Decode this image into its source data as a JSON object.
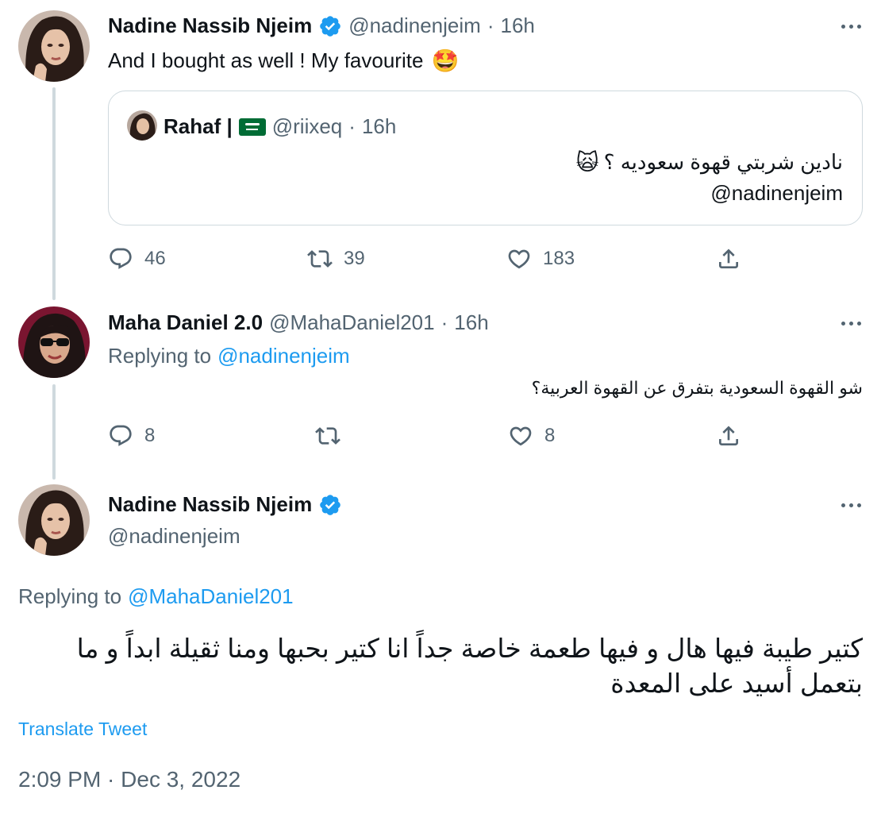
{
  "tweet1": {
    "name": "Nadine Nassib Njeim",
    "handle": "@nadinenjeim",
    "sep": "·",
    "time": "16h",
    "text": "And I bought as well ! My favourite",
    "emoji": "🤩",
    "quote": {
      "name": "Rahaf |",
      "handle": "@riixeq",
      "sep": "·",
      "time": "16h",
      "line1": "نادين شربتي قهوة سعوديه ؟",
      "line1_emoji": "🙀",
      "line2": "@nadinenjeim"
    },
    "counts": {
      "replies": "46",
      "retweets": "39",
      "likes": "183"
    }
  },
  "tweet2": {
    "name": "Maha Daniel 2.0",
    "handle": "@MahaDaniel201",
    "sep": "·",
    "time": "16h",
    "replying_prefix": "Replying to",
    "replying_handle": "@nadinenjeim",
    "text": "شو القهوة السعودية بتفرق عن القهوة العربية؟",
    "counts": {
      "replies": "8",
      "retweets": "",
      "likes": "8"
    }
  },
  "tweet3": {
    "name": "Nadine Nassib Njeim",
    "handle": "@nadinenjeim",
    "replying_prefix": "Replying to",
    "replying_handle": "@MahaDaniel201",
    "text_line1": "كتير طيبة فيها هال و فيها طعمة خاصة جداً انا كتير بحبها ومنا ثقيلة ابداً و ما",
    "text_line2": "بتعمل أسيد على المعدة",
    "translate": "Translate Tweet",
    "timestamp": "2:09 PM · Dec 3, 2022"
  },
  "colors": {
    "accent": "#1d9bf0",
    "muted": "#536471",
    "border": "#cfd9de",
    "text": "#0f1419",
    "saudi_flag": "#006c35"
  },
  "icons": [
    "verified-badge-icon",
    "more-icon",
    "reply-icon",
    "retweet-icon",
    "like-icon",
    "share-icon",
    "saudi-flag-icon"
  ]
}
